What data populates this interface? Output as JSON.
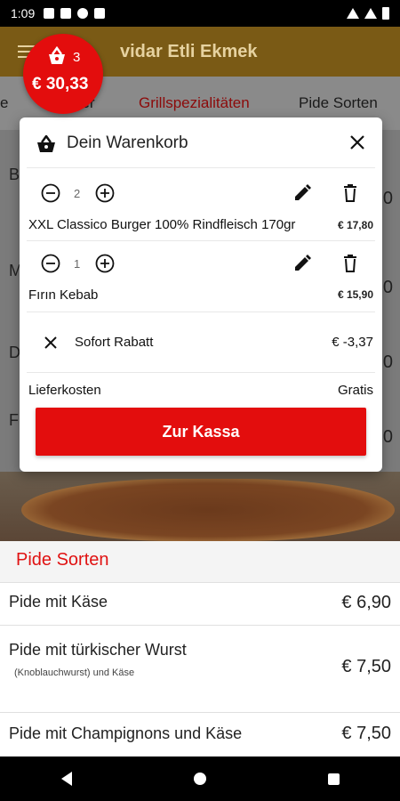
{
  "status": {
    "time": "1:09"
  },
  "appbar": {
    "title": "vidar Etli Ekmek"
  },
  "tabs": [
    {
      "label": "e",
      "active": false
    },
    {
      "label": "ger",
      "active": false
    },
    {
      "label": "Grillspezialitäten",
      "active": true
    },
    {
      "label": "Pide Sorten",
      "active": false
    }
  ],
  "background_list": {
    "rows": [
      {
        "label": "B",
        "price": "0"
      },
      {
        "label": "M",
        "price": "0"
      },
      {
        "label": "D",
        "price": "0"
      },
      {
        "label": "F",
        "price": "0"
      }
    ]
  },
  "cart_badge": {
    "count": "3",
    "total": "€ 30,33"
  },
  "cart": {
    "title": "Dein Warenkorb",
    "items": [
      {
        "qty": "2",
        "name": "XXL Classico Burger 100% Rindfleisch 170gr",
        "price": "€ 17,80"
      },
      {
        "qty": "1",
        "name": "Fırın Kebab",
        "price": "€ 15,90"
      }
    ],
    "discount": {
      "label": "Sofort Rabatt",
      "value": "€ -3,37"
    },
    "delivery": {
      "label": "Lieferkosten",
      "value": "Gratis"
    },
    "checkout_label": "Zur Kassa"
  },
  "menu": {
    "section_title": "Pide Sorten",
    "items": [
      {
        "name": "Pide mit Käse",
        "sub": "",
        "price": "€ 6,90"
      },
      {
        "name": "Pide mit türkischer Wurst",
        "sub": "(Knoblauchwurst) und Käse",
        "price": "€ 7,50"
      },
      {
        "name": "Pide mit Champignons und Käse",
        "sub": "",
        "price": "€ 7,50"
      }
    ]
  },
  "colors": {
    "accent": "#e30d0d",
    "appbar": "#7a5a15",
    "section_title": "#e01212"
  }
}
